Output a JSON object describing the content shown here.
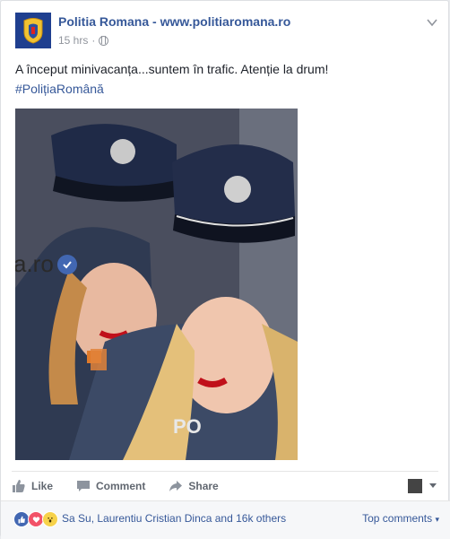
{
  "post": {
    "page_name": "Politia Romana - www.politiaromana.ro",
    "timestamp": "15 hrs",
    "separator": "·",
    "audience_icon": "globe-icon",
    "text": "A început minivacanța...suntem în trafic. Atenție la drum!",
    "hashtag": "#PolițiaRomână",
    "photo_overlay_text": "a.ro",
    "photo_overlay_icon": "verified-check-icon"
  },
  "actions": {
    "like": "Like",
    "comment": "Comment",
    "share": "Share"
  },
  "reactions": {
    "icons": [
      "like-reaction-icon",
      "love-reaction-icon",
      "wow-reaction-icon"
    ],
    "summary": "Sa Su, Laurentiu Cristian Dinca and 16k others",
    "sort_label": "Top comments"
  },
  "colors": {
    "link": "#365899",
    "muted": "#90949c",
    "like_blue": "#4267b2",
    "love_red": "#f25268",
    "wow_yellow": "#f7d24a"
  }
}
